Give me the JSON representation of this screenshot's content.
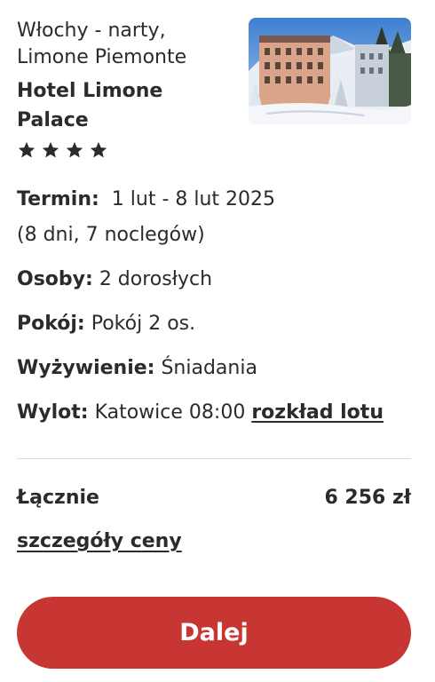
{
  "offer": {
    "location_line1": "Włochy - narty,",
    "location_line2": "Limone Piemonte",
    "hotel_line1": "Hotel Limone",
    "hotel_line2": "Palace",
    "stars": 4,
    "icon": "star-icon"
  },
  "details": {
    "termin_label": "Termin:",
    "termin_value": "1 lut - 8 lut 2025",
    "termin_duration": "(8 dni, 7 noclegów)",
    "osoby_label": "Osoby:",
    "osoby_value": "2 dorosłych",
    "pokoj_label": "Pokój:",
    "pokoj_value": "Pokój 2 os.",
    "wyzywienie_label": "Wyżywienie:",
    "wyzywienie_value": "Śniadania",
    "wylot_label": "Wylot:",
    "wylot_value": "Katowice 08:00",
    "wylot_link": "rozkład lotu"
  },
  "summary": {
    "total_label": "Łącznie",
    "total_value": "6 256 zł",
    "price_details_link": "szczegóły ceny"
  },
  "cta": {
    "label": "Dalej",
    "color": "#c73632"
  }
}
